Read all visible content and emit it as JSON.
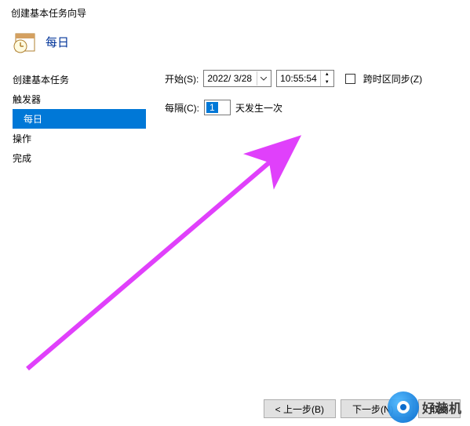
{
  "window": {
    "title": "创建基本任务向导"
  },
  "header": {
    "heading": "每日"
  },
  "sidebar": {
    "items": [
      {
        "label": "创建基本任务",
        "active": false,
        "indent": false
      },
      {
        "label": "触发器",
        "active": false,
        "indent": false
      },
      {
        "label": "每日",
        "active": true,
        "indent": true
      },
      {
        "label": "操作",
        "active": false,
        "indent": false
      },
      {
        "label": "完成",
        "active": false,
        "indent": false
      }
    ]
  },
  "form": {
    "start_label": "开始(S):",
    "date_value": "2022/ 3/28",
    "time_value": "10:55:54",
    "tz_sync_label": "跨时区同步(Z)",
    "interval_label": "每隔(C):",
    "interval_value": "1",
    "interval_suffix": "天发生一次"
  },
  "footer": {
    "back": "< 上一步(B)",
    "next": "下一步(N) >",
    "cancel": "取消"
  },
  "watermark": {
    "text": "好装机"
  }
}
